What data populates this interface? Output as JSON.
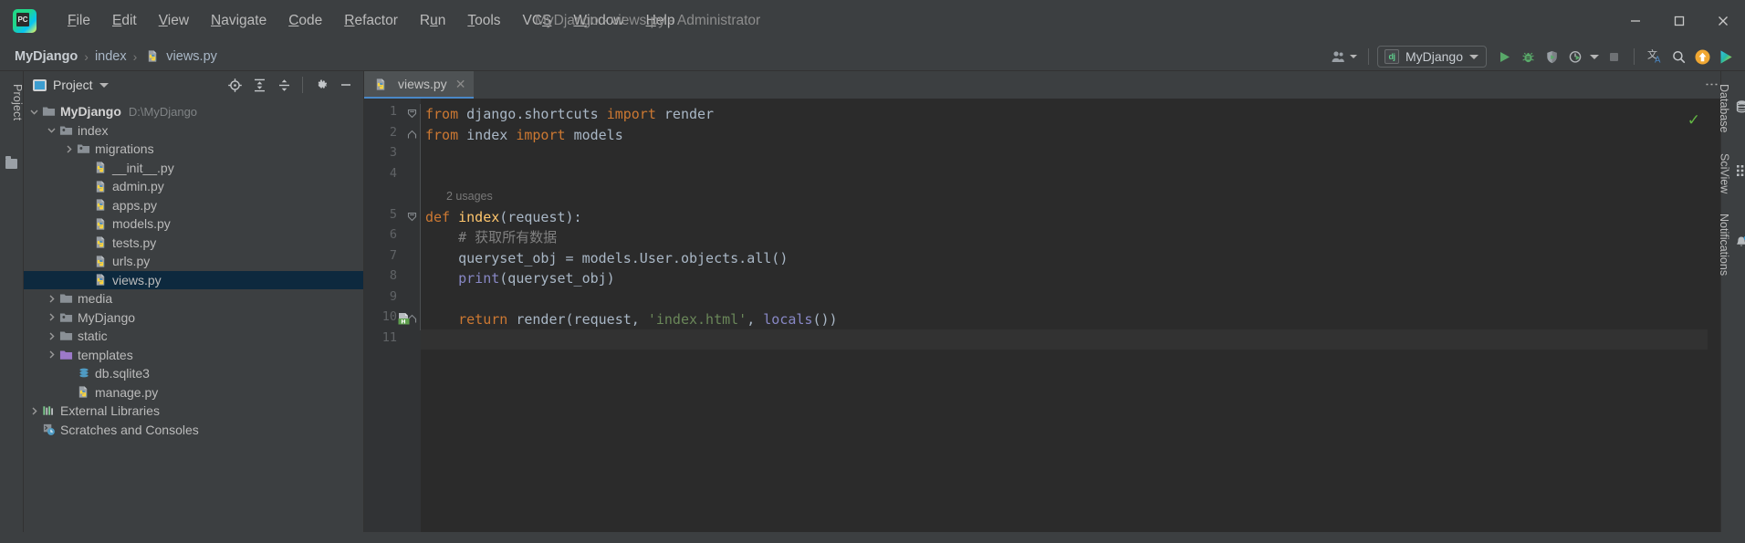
{
  "window": {
    "title": "MyDjango - views.py - Administrator",
    "logo_label": "PC",
    "minimize_icon": "minimize-icon",
    "maximize_icon": "maximize-icon",
    "close_icon": "close-icon"
  },
  "menubar": {
    "items": [
      {
        "label": "File",
        "mnemonic": "F"
      },
      {
        "label": "Edit",
        "mnemonic": "E"
      },
      {
        "label": "View",
        "mnemonic": "V"
      },
      {
        "label": "Navigate",
        "mnemonic": "N"
      },
      {
        "label": "Code",
        "mnemonic": "C"
      },
      {
        "label": "Refactor",
        "mnemonic": "R"
      },
      {
        "label": "Run",
        "mnemonic": "u"
      },
      {
        "label": "Tools",
        "mnemonic": "T"
      },
      {
        "label": "VCS",
        "mnemonic": "S"
      },
      {
        "label": "Window",
        "mnemonic": "W"
      },
      {
        "label": "Help",
        "mnemonic": "H"
      }
    ]
  },
  "breadcrumb": {
    "separator": "›",
    "items": [
      {
        "label": "MyDjango",
        "bold": true,
        "icon": ""
      },
      {
        "label": "index",
        "bold": false,
        "icon": ""
      },
      {
        "label": "views.py",
        "bold": false,
        "icon": "python-file-icon"
      }
    ]
  },
  "toolbar": {
    "account_icon": "user-account-icon",
    "run_config": {
      "label": "MyDjango",
      "icon": "django-icon",
      "icon_text": "dj",
      "dropdown_icon": "chevron-down-icon"
    },
    "buttons": [
      {
        "name": "run-button",
        "icon": "run-icon",
        "tooltip": "Run"
      },
      {
        "name": "debug-button",
        "icon": "debug-bug-icon",
        "tooltip": "Debug"
      },
      {
        "name": "coverage-button",
        "icon": "coverage-icon",
        "tooltip": "Run with Coverage"
      },
      {
        "name": "profile-button",
        "icon": "profiler-icon",
        "tooltip": "Profile"
      },
      {
        "name": "more-run-options",
        "icon": "chevron-down-icon",
        "tooltip": "More"
      },
      {
        "name": "stop-button",
        "icon": "stop-square-icon",
        "tooltip": "Stop"
      },
      {
        "name": "translate-button",
        "icon": "translate-icon",
        "tooltip": "Translate"
      },
      {
        "name": "search-everywhere",
        "icon": "search-icon",
        "tooltip": "Search Everywhere"
      },
      {
        "name": "update-button",
        "icon": "update-arrow-icon",
        "tooltip": "Update"
      },
      {
        "name": "ai-assistant-button",
        "icon": "ai-assistant-icon",
        "tooltip": "AI Assistant"
      }
    ]
  },
  "left_strip": {
    "project_tab": "Project",
    "structure_icon": "structure-icon"
  },
  "project_panel": {
    "title": "Project",
    "view_icon": "project-view-icon",
    "dropdown_icon": "chevron-down-icon",
    "tools": [
      {
        "name": "select-opened-file-button",
        "icon": "crosshair-target-icon"
      },
      {
        "name": "expand-all-button",
        "icon": "expand-all-icon"
      },
      {
        "name": "collapse-all-button",
        "icon": "collapse-all-icon"
      },
      {
        "name": "settings-button",
        "icon": "gear-icon"
      },
      {
        "name": "hide-button",
        "icon": "minimize-line-icon"
      }
    ],
    "tree": [
      {
        "label": "MyDjango",
        "path": "D:\\MyDjango",
        "indent": 0,
        "arrow": "down",
        "icon": "folder-root-icon",
        "bold": true,
        "selected": false
      },
      {
        "label": "index",
        "path": "",
        "indent": 1,
        "arrow": "down",
        "icon": "folder-module-icon",
        "bold": false,
        "selected": false
      },
      {
        "label": "migrations",
        "path": "",
        "indent": 2,
        "arrow": "right",
        "icon": "folder-module-icon",
        "bold": false,
        "selected": false
      },
      {
        "label": "__init__.py",
        "path": "",
        "indent": 3,
        "arrow": "none",
        "icon": "python-file-icon",
        "bold": false,
        "selected": false
      },
      {
        "label": "admin.py",
        "path": "",
        "indent": 3,
        "arrow": "none",
        "icon": "python-file-icon",
        "bold": false,
        "selected": false
      },
      {
        "label": "apps.py",
        "path": "",
        "indent": 3,
        "arrow": "none",
        "icon": "python-file-icon",
        "bold": false,
        "selected": false
      },
      {
        "label": "models.py",
        "path": "",
        "indent": 3,
        "arrow": "none",
        "icon": "python-file-icon",
        "bold": false,
        "selected": false
      },
      {
        "label": "tests.py",
        "path": "",
        "indent": 3,
        "arrow": "none",
        "icon": "python-file-icon",
        "bold": false,
        "selected": false
      },
      {
        "label": "urls.py",
        "path": "",
        "indent": 3,
        "arrow": "none",
        "icon": "python-file-icon",
        "bold": false,
        "selected": false
      },
      {
        "label": "views.py",
        "path": "",
        "indent": 3,
        "arrow": "none",
        "icon": "python-file-icon",
        "bold": false,
        "selected": true
      },
      {
        "label": "media",
        "path": "",
        "indent": 1,
        "arrow": "right",
        "icon": "folder-icon",
        "bold": false,
        "selected": false
      },
      {
        "label": "MyDjango",
        "path": "",
        "indent": 1,
        "arrow": "right",
        "icon": "folder-module-icon",
        "bold": false,
        "selected": false
      },
      {
        "label": "static",
        "path": "",
        "indent": 1,
        "arrow": "right",
        "icon": "folder-icon",
        "bold": false,
        "selected": false
      },
      {
        "label": "templates",
        "path": "",
        "indent": 1,
        "arrow": "right",
        "icon": "folder-templates-icon",
        "bold": false,
        "selected": false
      },
      {
        "label": "db.sqlite3",
        "path": "",
        "indent": 2,
        "arrow": "none",
        "icon": "database-file-icon",
        "bold": false,
        "selected": false
      },
      {
        "label": "manage.py",
        "path": "",
        "indent": 2,
        "arrow": "none",
        "icon": "python-file-icon",
        "bold": false,
        "selected": false
      },
      {
        "label": "External Libraries",
        "path": "",
        "indent": 0,
        "arrow": "right",
        "icon": "libraries-icon",
        "bold": false,
        "selected": false
      },
      {
        "label": "Scratches and Consoles",
        "path": "",
        "indent": 0,
        "arrow": "none",
        "icon": "scratches-icon",
        "bold": false,
        "selected": false
      }
    ]
  },
  "editor": {
    "tab": {
      "label": "views.py",
      "icon": "python-file-icon",
      "close_icon": "close-icon"
    },
    "options_icon": "more-options-icon",
    "inspection_status_icon": "inspection-ok-icon",
    "gutter_icons": [
      {
        "line": 10,
        "icon": "html-template-icon",
        "label": "H"
      }
    ],
    "inlay_hints": [
      {
        "after_line": 4,
        "text": "2 usages"
      }
    ],
    "lines": [
      {
        "n": 1,
        "tokens": [
          {
            "t": "from ",
            "c": "k"
          },
          {
            "t": "django.shortcuts ",
            "c": "id"
          },
          {
            "t": "import ",
            "c": "k"
          },
          {
            "t": "render",
            "c": "id"
          }
        ]
      },
      {
        "n": 2,
        "tokens": [
          {
            "t": "from ",
            "c": "k"
          },
          {
            "t": "index ",
            "c": "id"
          },
          {
            "t": "import ",
            "c": "k"
          },
          {
            "t": "models",
            "c": "id"
          }
        ]
      },
      {
        "n": 3,
        "tokens": []
      },
      {
        "n": 4,
        "tokens": []
      },
      {
        "n": 5,
        "tokens": [
          {
            "t": "def ",
            "c": "k"
          },
          {
            "t": "index",
            "c": "fn"
          },
          {
            "t": "(request):",
            "c": "id"
          }
        ]
      },
      {
        "n": 6,
        "tokens": [
          {
            "t": "    # 获取所有数据",
            "c": "cm"
          }
        ]
      },
      {
        "n": 7,
        "tokens": [
          {
            "t": "    queryset_obj = models.User.objects.all()",
            "c": "id"
          }
        ]
      },
      {
        "n": 8,
        "tokens": [
          {
            "t": "    ",
            "c": "id"
          },
          {
            "t": "print",
            "c": "bi"
          },
          {
            "t": "(queryset_obj)",
            "c": "id"
          }
        ]
      },
      {
        "n": 9,
        "tokens": []
      },
      {
        "n": 10,
        "tokens": [
          {
            "t": "    ",
            "c": "id"
          },
          {
            "t": "return ",
            "c": "k"
          },
          {
            "t": "render(request, ",
            "c": "id"
          },
          {
            "t": "'index.html'",
            "c": "st"
          },
          {
            "t": ", ",
            "c": "id"
          },
          {
            "t": "locals",
            "c": "bi"
          },
          {
            "t": "())",
            "c": "id"
          }
        ]
      },
      {
        "n": 11,
        "tokens": []
      }
    ]
  },
  "right_strip": {
    "tabs": [
      {
        "label": "Database",
        "icon": "database-icon",
        "badge": false
      },
      {
        "label": "SciView",
        "icon": "sciview-grid-icon",
        "badge": false
      },
      {
        "label": "Notifications",
        "icon": "bell-icon",
        "badge": true
      }
    ]
  },
  "colors": {
    "background": "#3c3f41",
    "editor_bg": "#2b2b2b",
    "gutter_bg": "#313335",
    "selection": "#0d293e",
    "accent_blue": "#4a88c7",
    "keyword": "#cc7832",
    "function": "#ffc66d",
    "string": "#6a8759",
    "builtin": "#8888c6",
    "comment": "#808080",
    "text": "#a9b7c6",
    "ok_green": "#62b543"
  }
}
